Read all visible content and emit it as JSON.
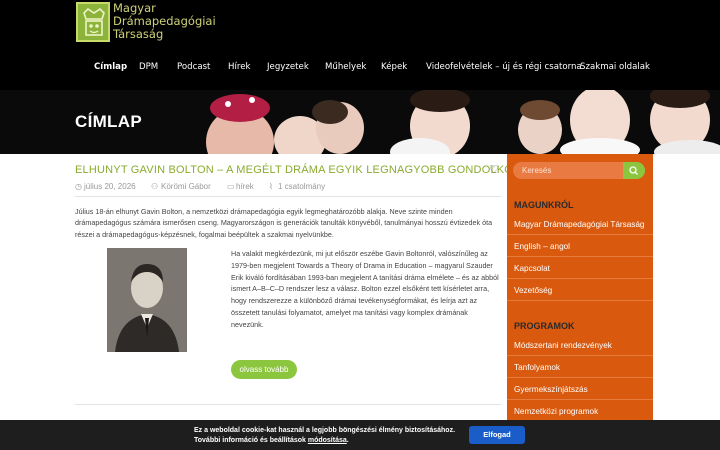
{
  "site": {
    "logo_alt": "crown-logo",
    "name_line1": "Magyar",
    "name_line2": "Drámapedagógiai",
    "name_line3": "Társaság"
  },
  "nav": {
    "items": [
      {
        "label": "Címlap"
      },
      {
        "label": "DPM"
      },
      {
        "label": "Podcast"
      },
      {
        "label": "Hírek"
      },
      {
        "label": "Jegyzetek"
      },
      {
        "label": "Műhelyek"
      },
      {
        "label": "Képek"
      },
      {
        "label": "Videofelvételek – új és régi csatorna"
      },
      {
        "label": "Szakmai oldalak"
      }
    ]
  },
  "banner": {
    "title": "CÍMLAP"
  },
  "post": {
    "title": "ELHUNYT GAVIN BOLTON – A MEGÉLT DRÁMA EGYIK LEGNAGYOBB GONDOLKODÓJA",
    "date": "július 20, 2026",
    "author": "Körömi Gábor",
    "category": "hírek",
    "attachments": "1 csatolmány",
    "intro": "Július 18-án elhunyt Gavin Bolton, a nemzetközi drámapedagógia egyik legmeghatározóbb alakja. Neve szinte minden drámapedagógus számára ismerősen cseng. Magyarországon is generációk tanulták könyvéből, tanulmányai hosszú évtizedek óta részei a drámapedagógus-képzésnek, fogalmai beépültek a szakmai nyelvünkbe.",
    "body": "Ha valakit megkérdezünk, mi jut először eszébe Gavin Boltonról, valószínűleg az 1979-ben megjelent Towards a Theory of Drama in Education – magyarul Szauder Erik kiváló fordításában 1993-ban megjelent A tanítási dráma elmélete – és az abból ismert A–B–C–D rendszer lesz a válasz. Bolton ezzel elsőként tett kísérletet arra, hogy rendszerezze a különböző drámai tevékenységformákat, és leírja azt az összetett tanulási folyamatot, amelyet ma tanítási vagy komplex drámának nevezünk.",
    "read_more": "olvass tovább"
  },
  "sidebar": {
    "search_placeholder": "Keresés",
    "section1_title": "MAGUNKRÓL",
    "section1_items": [
      {
        "label": "Magyar Drámapedagógiai Társaság"
      },
      {
        "label": "English – angol"
      },
      {
        "label": "Kapcsolat"
      },
      {
        "label": "Vezetőség"
      }
    ],
    "section2_title": "PROGRAMOK",
    "section2_items": [
      {
        "label": "Módszertani rendezvények"
      },
      {
        "label": "Tanfolyamok"
      },
      {
        "label": "Gyermekszínjátszás"
      },
      {
        "label": "Nemzetközi programok"
      }
    ]
  },
  "cookie": {
    "line1": "Ez a weboldal cookie-kat használ a legjobb böngészési élmény biztosításához.",
    "line2_prefix": "További információ és beállítások",
    "line2_link": "módosítása",
    "line2_suffix": ".",
    "button": "Elfogad"
  },
  "colors": {
    "accent_green": "#8cc63e",
    "sidebar_orange": "#d95a0f",
    "cookie_button": "#1a5dc8"
  }
}
